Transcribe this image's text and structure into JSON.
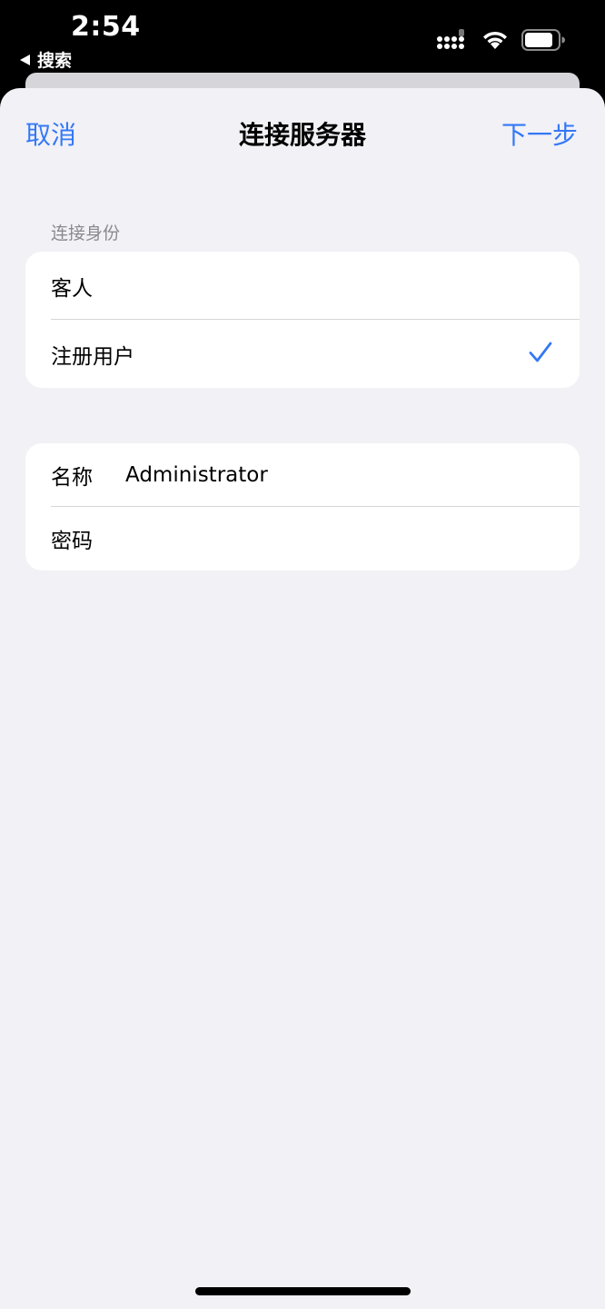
{
  "status_bar": {
    "time": "2:54",
    "back_app": "搜索",
    "signal_icon": "cellular-signal-icon",
    "wifi_icon": "wifi-icon",
    "battery_icon": "battery-icon"
  },
  "nav": {
    "cancel_label": "取消",
    "title": "连接服务器",
    "next_label": "下一步"
  },
  "identity_section": {
    "header": "连接身份",
    "options": [
      {
        "label": "客人",
        "selected": false
      },
      {
        "label": "注册用户",
        "selected": true
      }
    ],
    "check_icon": "checkmark-icon"
  },
  "login_section": {
    "name_label": "名称",
    "name_value": "Administrator",
    "password_label": "密码",
    "password_value": ""
  },
  "colors": {
    "accent": "#3478f6",
    "background": "#f1f1f6",
    "secondary_text": "#8a8a8e"
  }
}
